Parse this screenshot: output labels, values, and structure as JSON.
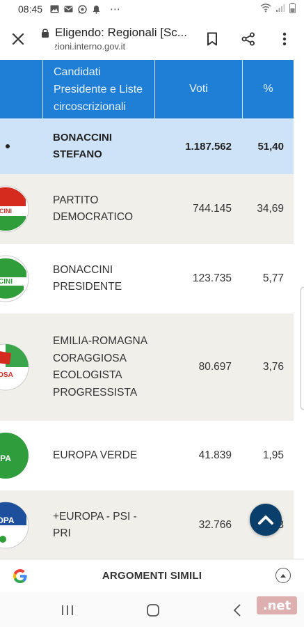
{
  "status_bar": {
    "time": "08:45",
    "more": "⋯"
  },
  "browser": {
    "title": "Eligendo: Regionali [Sc...",
    "url": "elezioni.interno.gov.it"
  },
  "table": {
    "headers": {
      "candidates": "Candidati Presidente e Liste circoscrizionali",
      "votes": "Voti",
      "percent": "%"
    },
    "total_row": {
      "name": "BONACCINI STEFANO",
      "votes": "1.187.562",
      "percent": "51,40"
    },
    "rows": [
      {
        "name": "PARTITO DEMOCRATICO",
        "votes": "744.145",
        "percent": "34,69",
        "logo_color": "#d52b1e",
        "logo_text": "CINI"
      },
      {
        "name": "BONACCINI PRESIDENTE",
        "votes": "123.735",
        "percent": "5,77",
        "logo_color": "#2e9d3a",
        "logo_text": "CINI"
      },
      {
        "name": "EMILIA-ROMAGNA CORAGGIOSA ECOLOGISTA PROGRESSISTA",
        "votes": "80.697",
        "percent": "3,76",
        "logo_color": "#3aa54a",
        "logo_text": "OSA"
      },
      {
        "name": "EUROPA VERDE",
        "votes": "41.839",
        "percent": "1,95",
        "logo_color": "#2f9d3c",
        "logo_text": "PA"
      },
      {
        "name": "+EUROPA - PSI - PRI",
        "votes": "32.766",
        "percent": "1,53",
        "logo_color": "#1d4f9c",
        "logo_text": "OPA"
      }
    ]
  },
  "google_bar": {
    "label": "ARGOMENTI SIMILI"
  },
  "watermark": ".net",
  "colors": {
    "header_blue": "#1f7fd6",
    "total_row_bg": "#cfe3f8",
    "odd_row_bg": "#f0efe9",
    "scroll_button": "#0a3f6b"
  }
}
